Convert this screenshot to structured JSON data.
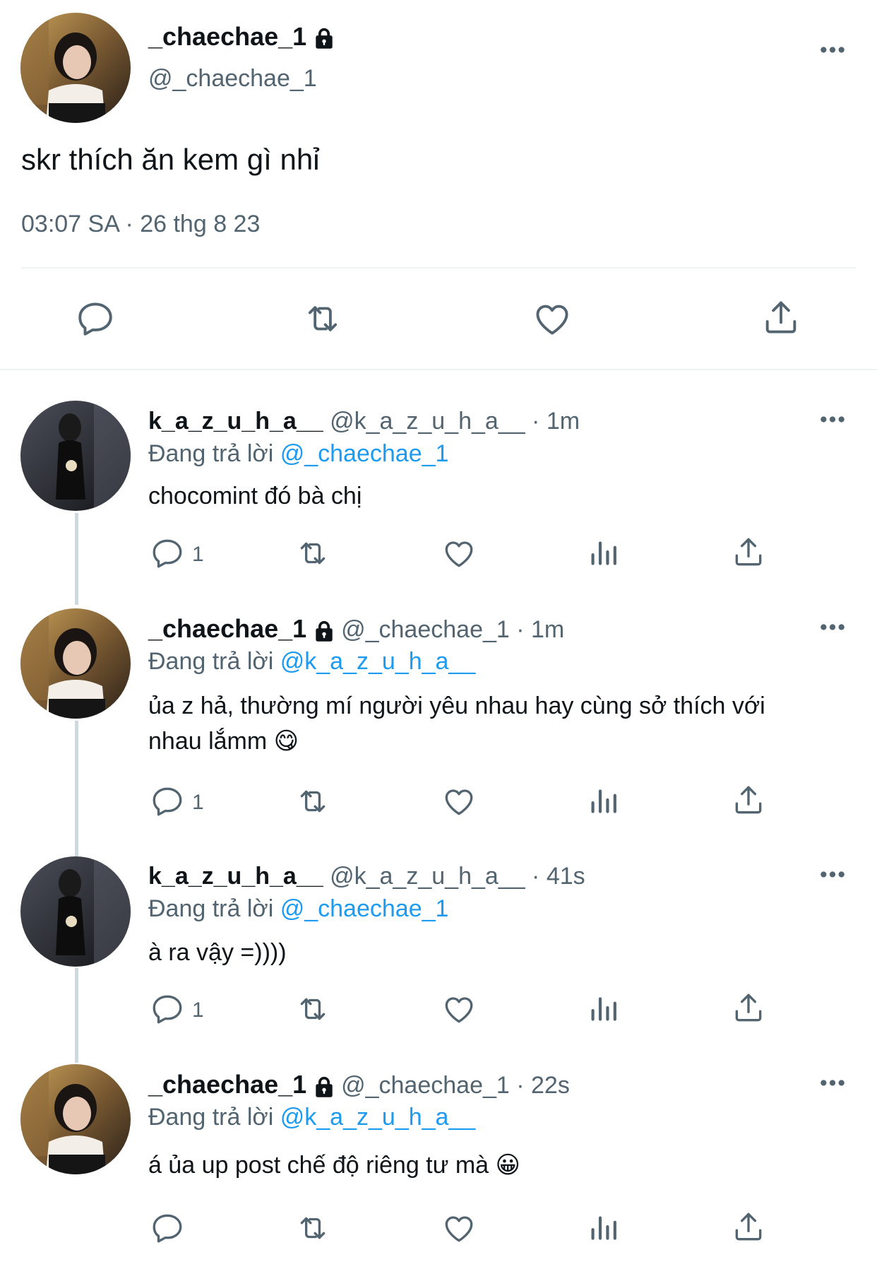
{
  "main_tweet": {
    "display_name": "_chaechae_1",
    "handle": "@_chaechae_1",
    "text": "skr thích ăn kem gì nhỉ",
    "meta": "03:07 SA · 26 thg 8 23"
  },
  "replies": [
    {
      "display_name": "k_a_z_u_h_a__",
      "handle_time": "@k_a_z_u_h_a__ · 1m",
      "replying_prefix": "Đang trả lời",
      "replying_to": "@_chaechae_1",
      "text": "chocomint đó bà chị",
      "reply_count": "1"
    },
    {
      "display_name": "_chaechae_1",
      "handle_time": "@_chaechae_1 · 1m",
      "replying_prefix": "Đang trả lời",
      "replying_to": "@k_a_z_u_h_a__",
      "text_line1": "ủa z hả, thường mí người yêu nhau hay cùng sở thích với",
      "text_line2": "nhau lắmm 😋",
      "reply_count": "1"
    },
    {
      "display_name": "k_a_z_u_h_a__",
      "handle_time": "@k_a_z_u_h_a__ · 41s",
      "replying_prefix": "Đang trả lời",
      "replying_to": "@_chaechae_1",
      "text": "à ra vậy =))))",
      "reply_count": "1"
    },
    {
      "display_name": "_chaechae_1",
      "handle_time": "@_chaechae_1 · 22s",
      "replying_prefix": "Đang trả lời",
      "replying_to": "@k_a_z_u_h_a__",
      "text": "á ủa up post chế độ riêng tư mà 😀"
    }
  ],
  "icons": {
    "reply": "reply-icon",
    "retweet": "retweet-icon",
    "like": "heart-icon",
    "views": "views-icon",
    "share": "share-icon",
    "more": "more-icon",
    "lock": "lock-icon"
  },
  "colors": {
    "text": "#0f1419",
    "muted": "#536471",
    "link": "#1d9bf0",
    "divider": "#eff3f4"
  }
}
